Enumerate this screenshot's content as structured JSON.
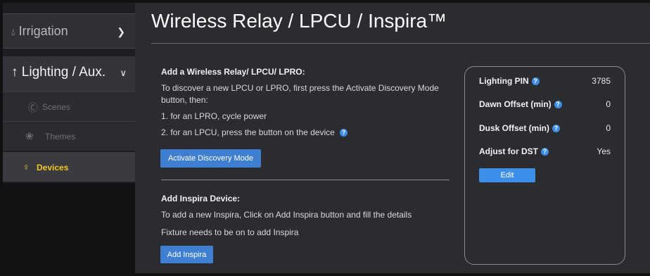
{
  "sidebar": {
    "irrigation": {
      "label": "Irrigation"
    },
    "lighting": {
      "label": "Lighting / Aux."
    },
    "items": [
      {
        "label": "Scenes"
      },
      {
        "label": "Themes"
      },
      {
        "label": "Devices"
      }
    ]
  },
  "main": {
    "title": "Wireless Relay / LPCU / Inspira™",
    "relay_section": {
      "heading": "Add a Wireless Relay/ LPCU/ LPRO:",
      "intro_line1": "To discover a new LPCU or LPRO, first press the Activate Discovery Mode",
      "intro_line2": "button, then:",
      "step1": "1. for an LPRO, cycle power",
      "step2": "2. for an LPCU, press the button on the device",
      "button": "Activate Discovery Mode"
    },
    "inspira_section": {
      "heading": "Add Inspira Device:",
      "line1": "To add a new Inspira, Click on Add Inspira button and fill the details",
      "line2": "Fixture needs to be on to add Inspira",
      "button": "Add Inspira"
    }
  },
  "settings": {
    "rows": [
      {
        "label": "Lighting PIN",
        "value": "3785"
      },
      {
        "label": "Dawn Offset (min)",
        "value": "0"
      },
      {
        "label": "Dusk Offset (min)",
        "value": "0"
      },
      {
        "label": "Adjust for DST",
        "value": "Yes"
      }
    ],
    "edit_button": "Edit"
  },
  "colors": {
    "accent_blue": "#3f7fd1",
    "active_yellow": "#f5c518",
    "background": "#2b2c30"
  },
  "icons": [
    "water-drop-icon",
    "chevron-right-icon",
    "up-arrow-icon",
    "chevron-down-icon",
    "scenes-icon",
    "themes-icon",
    "lightbulb-icon",
    "help-icon"
  ]
}
